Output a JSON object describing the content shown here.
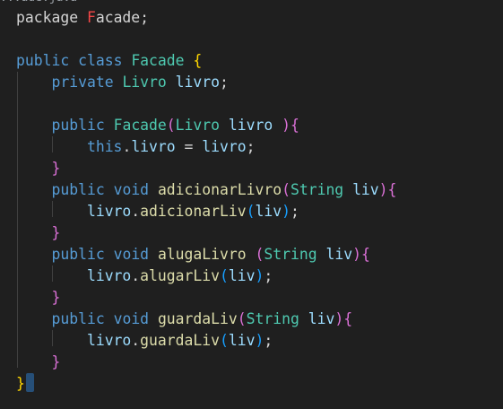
{
  "editor": {
    "tab_fragment": "...ade.java",
    "lines": [
      {
        "tokens": [
          {
            "t": "package",
            "c": "plain"
          },
          {
            "t": " ",
            "c": "plain"
          },
          {
            "t": "F",
            "c": "red"
          },
          {
            "t": "acade",
            "c": "plain"
          },
          {
            "t": ";",
            "c": "plain"
          }
        ]
      },
      {
        "tokens": []
      },
      {
        "tokens": [
          {
            "t": "public",
            "c": "kw"
          },
          {
            "t": " ",
            "c": "plain"
          },
          {
            "t": "class",
            "c": "kw"
          },
          {
            "t": " ",
            "c": "plain"
          },
          {
            "t": "Facade",
            "c": "ty"
          },
          {
            "t": " ",
            "c": "plain"
          },
          {
            "t": "{",
            "c": "gold"
          }
        ]
      },
      {
        "tokens": [
          {
            "t": "    ",
            "c": "plain"
          },
          {
            "t": "private",
            "c": "kw"
          },
          {
            "t": " ",
            "c": "plain"
          },
          {
            "t": "Livro",
            "c": "ty"
          },
          {
            "t": " ",
            "c": "plain"
          },
          {
            "t": "livro",
            "c": "var"
          },
          {
            "t": ";",
            "c": "plain"
          }
        ]
      },
      {
        "tokens": []
      },
      {
        "tokens": [
          {
            "t": "    ",
            "c": "plain"
          },
          {
            "t": "public",
            "c": "kw"
          },
          {
            "t": " ",
            "c": "plain"
          },
          {
            "t": "Facade",
            "c": "ty"
          },
          {
            "t": "(",
            "c": "pink"
          },
          {
            "t": "Livro",
            "c": "ty"
          },
          {
            "t": " ",
            "c": "plain"
          },
          {
            "t": "livro",
            "c": "var"
          },
          {
            "t": " ",
            "c": "plain"
          },
          {
            "t": ")",
            "c": "pink"
          },
          {
            "t": "{",
            "c": "pink"
          }
        ]
      },
      {
        "tokens": [
          {
            "t": "        ",
            "c": "plain"
          },
          {
            "t": "this",
            "c": "kw"
          },
          {
            "t": ".",
            "c": "plain"
          },
          {
            "t": "livro",
            "c": "var"
          },
          {
            "t": " = ",
            "c": "plain"
          },
          {
            "t": "livro",
            "c": "var"
          },
          {
            "t": ";",
            "c": "plain"
          }
        ]
      },
      {
        "tokens": [
          {
            "t": "    ",
            "c": "plain"
          },
          {
            "t": "}",
            "c": "pink"
          }
        ]
      },
      {
        "tokens": [
          {
            "t": "    ",
            "c": "plain"
          },
          {
            "t": "public",
            "c": "kw"
          },
          {
            "t": " ",
            "c": "plain"
          },
          {
            "t": "void",
            "c": "kw"
          },
          {
            "t": " ",
            "c": "plain"
          },
          {
            "t": "adicionarLivro",
            "c": "fn"
          },
          {
            "t": "(",
            "c": "pink"
          },
          {
            "t": "String",
            "c": "ty"
          },
          {
            "t": " ",
            "c": "plain"
          },
          {
            "t": "liv",
            "c": "var"
          },
          {
            "t": ")",
            "c": "pink"
          },
          {
            "t": "{",
            "c": "pink"
          }
        ]
      },
      {
        "tokens": [
          {
            "t": "        ",
            "c": "plain"
          },
          {
            "t": "livro",
            "c": "var"
          },
          {
            "t": ".",
            "c": "plain"
          },
          {
            "t": "adicionarLiv",
            "c": "fn"
          },
          {
            "t": "(",
            "c": "blue"
          },
          {
            "t": "liv",
            "c": "var"
          },
          {
            "t": ")",
            "c": "blue"
          },
          {
            "t": ";",
            "c": "plain"
          }
        ]
      },
      {
        "tokens": [
          {
            "t": "    ",
            "c": "plain"
          },
          {
            "t": "}",
            "c": "pink"
          }
        ]
      },
      {
        "tokens": [
          {
            "t": "    ",
            "c": "plain"
          },
          {
            "t": "public",
            "c": "kw"
          },
          {
            "t": " ",
            "c": "plain"
          },
          {
            "t": "void",
            "c": "kw"
          },
          {
            "t": " ",
            "c": "plain"
          },
          {
            "t": "alugaLivro",
            "c": "fn"
          },
          {
            "t": " ",
            "c": "plain"
          },
          {
            "t": "(",
            "c": "pink"
          },
          {
            "t": "String",
            "c": "ty"
          },
          {
            "t": " ",
            "c": "plain"
          },
          {
            "t": "liv",
            "c": "var"
          },
          {
            "t": ")",
            "c": "pink"
          },
          {
            "t": "{",
            "c": "pink"
          }
        ]
      },
      {
        "tokens": [
          {
            "t": "        ",
            "c": "plain"
          },
          {
            "t": "livro",
            "c": "var"
          },
          {
            "t": ".",
            "c": "plain"
          },
          {
            "t": "alugarLiv",
            "c": "fn"
          },
          {
            "t": "(",
            "c": "blue"
          },
          {
            "t": "liv",
            "c": "var"
          },
          {
            "t": ")",
            "c": "blue"
          },
          {
            "t": ";",
            "c": "plain"
          }
        ]
      },
      {
        "tokens": [
          {
            "t": "    ",
            "c": "plain"
          },
          {
            "t": "}",
            "c": "pink"
          }
        ]
      },
      {
        "tokens": [
          {
            "t": "    ",
            "c": "plain"
          },
          {
            "t": "public",
            "c": "kw"
          },
          {
            "t": " ",
            "c": "plain"
          },
          {
            "t": "void",
            "c": "kw"
          },
          {
            "t": " ",
            "c": "plain"
          },
          {
            "t": "guardaLiv",
            "c": "fn"
          },
          {
            "t": "(",
            "c": "pink"
          },
          {
            "t": "String",
            "c": "ty"
          },
          {
            "t": " ",
            "c": "plain"
          },
          {
            "t": "liv",
            "c": "var"
          },
          {
            "t": ")",
            "c": "pink"
          },
          {
            "t": "{",
            "c": "pink"
          }
        ]
      },
      {
        "tokens": [
          {
            "t": "        ",
            "c": "plain"
          },
          {
            "t": "livro",
            "c": "var"
          },
          {
            "t": ".",
            "c": "plain"
          },
          {
            "t": "guardaLiv",
            "c": "fn"
          },
          {
            "t": "(",
            "c": "blue"
          },
          {
            "t": "liv",
            "c": "var"
          },
          {
            "t": ")",
            "c": "blue"
          },
          {
            "t": ";",
            "c": "plain"
          }
        ]
      },
      {
        "tokens": [
          {
            "t": "    ",
            "c": "plain"
          },
          {
            "t": "}",
            "c": "pink"
          }
        ]
      },
      {
        "tokens": [
          {
            "t": "}",
            "c": "gold"
          }
        ]
      }
    ]
  }
}
